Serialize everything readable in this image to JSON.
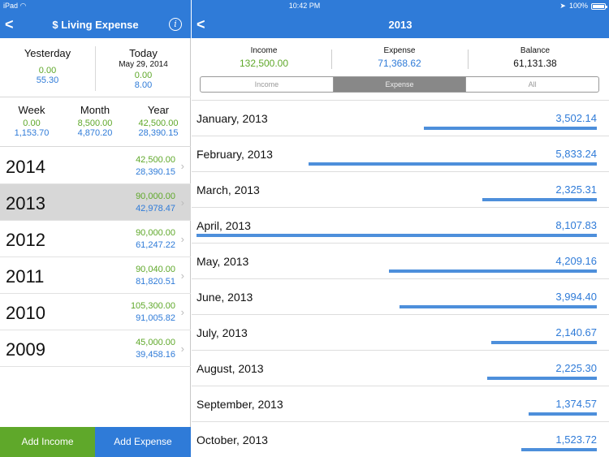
{
  "status_bar": {
    "device": "iPad",
    "time": "10:42 PM",
    "battery": "100%"
  },
  "left": {
    "title": "$ Living Expense",
    "yesterday": {
      "label": "Yesterday",
      "income": "0.00",
      "expense": "55.30"
    },
    "today": {
      "label": "Today",
      "date": "May 29, 2014",
      "income": "0.00",
      "expense": "8.00"
    },
    "week": {
      "label": "Week",
      "income": "0.00",
      "expense": "1,153.70"
    },
    "month": {
      "label": "Month",
      "income": "8,500.00",
      "expense": "4,870.20"
    },
    "year": {
      "label": "Year",
      "income": "42,500.00",
      "expense": "28,390.15"
    },
    "years": [
      {
        "name": "2014",
        "income": "42,500.00",
        "expense": "28,390.15",
        "selected": false
      },
      {
        "name": "2013",
        "income": "90,000.00",
        "expense": "42,978.47",
        "selected": true
      },
      {
        "name": "2012",
        "income": "90,000.00",
        "expense": "61,247.22",
        "selected": false
      },
      {
        "name": "2011",
        "income": "90,040.00",
        "expense": "81,820.51",
        "selected": false
      },
      {
        "name": "2010",
        "income": "105,300.00",
        "expense": "91,005.82",
        "selected": false
      },
      {
        "name": "2009",
        "income": "45,000.00",
        "expense": "39,458.16",
        "selected": false
      }
    ],
    "add_income_label": "Add Income",
    "add_expense_label": "Add Expense"
  },
  "right": {
    "title": "2013",
    "summary": {
      "income_label": "Income",
      "income_value": "132,500.00",
      "expense_label": "Expense",
      "expense_value": "71,368.62",
      "balance_label": "Balance",
      "balance_value": "61,131.38"
    },
    "segments": [
      "Income",
      "Expense",
      "All"
    ],
    "active_segment": 1,
    "months": [
      {
        "name": "January, 2013",
        "value": "3,502.14",
        "amount": 3502.14
      },
      {
        "name": "February, 2013",
        "value": "5,833.24",
        "amount": 5833.24
      },
      {
        "name": "March, 2013",
        "value": "2,325.31",
        "amount": 2325.31
      },
      {
        "name": "April, 2013",
        "value": "8,107.83",
        "amount": 8107.83
      },
      {
        "name": "May, 2013",
        "value": "4,209.16",
        "amount": 4209.16
      },
      {
        "name": "June, 2013",
        "value": "3,994.40",
        "amount": 3994.4
      },
      {
        "name": "July, 2013",
        "value": "2,140.67",
        "amount": 2140.67
      },
      {
        "name": "August, 2013",
        "value": "2,225.30",
        "amount": 2225.3
      },
      {
        "name": "September, 2013",
        "value": "1,374.57",
        "amount": 1374.57
      },
      {
        "name": "October, 2013",
        "value": "1,523.72",
        "amount": 1523.72
      }
    ]
  },
  "colors": {
    "accent_blue": "#2f7bd8",
    "income_green": "#5fa82a",
    "selected_row": "#d7d7d7"
  },
  "icons": {
    "back": "chevron-left-icon",
    "info": "info-icon",
    "row_chevron": "chevron-right-icon"
  }
}
